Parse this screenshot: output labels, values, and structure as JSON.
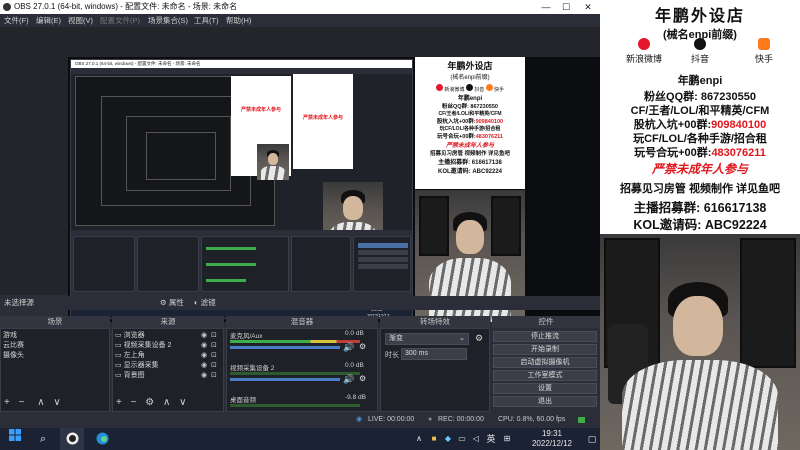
{
  "window": {
    "title": "OBS 27.0.1 (64-bit, windows) - 配置文件: 未命名 - 场景: 未命名"
  },
  "menu": [
    "文件(F)",
    "编辑(E)",
    "视图(V)",
    "配置文件(P)",
    "场景集合(S)",
    "工具(T)",
    "帮助(H)"
  ],
  "preview": {
    "nested_title": "OBS 27.0.1 (64-bit, windows) - 配置文件: 未命名 - 场景: 未命名",
    "nested_clock_time": "19:31",
    "nested_clock_date": "2022/12/12"
  },
  "no_source_selected": "未选择源",
  "properties_label": "属性",
  "filters_label": "滤镜",
  "docks": {
    "scenes": {
      "title": "场景",
      "items": [
        "游戏",
        "云比赛",
        "摄像头"
      ]
    },
    "sources": {
      "title": "来源",
      "items": [
        "浏览器",
        "视频采集设备 2",
        "左上角",
        "显示器采集",
        "背景图"
      ]
    },
    "mixer": {
      "title": "混音器",
      "channels": [
        {
          "name": "麦克风/Aux",
          "db": "0.0 dB"
        },
        {
          "name": "视频采集设备 2",
          "db": "0.0 dB"
        },
        {
          "name": "桌面音频",
          "db": "-9.8 dB"
        }
      ]
    },
    "transitions": {
      "title": "转场特效",
      "selected": "渐变",
      "duration_label": "时长",
      "duration_value": "300 ms"
    },
    "controls": {
      "title": "控件",
      "buttons": [
        "停止推流",
        "开始录制",
        "启动虚拟摄像机",
        "工作室模式",
        "设置",
        "退出"
      ]
    }
  },
  "status": {
    "live": "LIVE: 00:00:00",
    "rec": "REC: 00:00:00",
    "cpu": "CPU: 0.8%, 60.00 fps"
  },
  "poster": {
    "title": "年鹏外设店",
    "subtitle": "(械名enpi前缀)",
    "weibo": "新浪微博",
    "douyin": "抖音",
    "kuaishou": "快手",
    "name": "年鹏enpi",
    "fans_qq": "粉丝QQ群: 867230550",
    "games": "CF/王者/LOL/和平精英/CFM",
    "anti_label": "股杭入坑+00群:",
    "anti_value": "909840100",
    "wanf": "玩CF/LOL/各种手游/招合租",
    "hehe_label": "玩号合玩+00群:",
    "hehe_value": "483076211",
    "minor_warning": "严禁未成年人参与",
    "recruit": "招募见习房管 视频制作 详见鱼吧",
    "anchor": "主播招募群: 616617138",
    "kol": "KOL邀请码: ABC92224"
  },
  "taskbar": {
    "lang": "英",
    "time": "19:31",
    "date": "2022/12/12"
  },
  "colors": {
    "accent_red": "#e1171e",
    "obs_bg": "#2b2e38",
    "selection": "#4a6fa5"
  }
}
